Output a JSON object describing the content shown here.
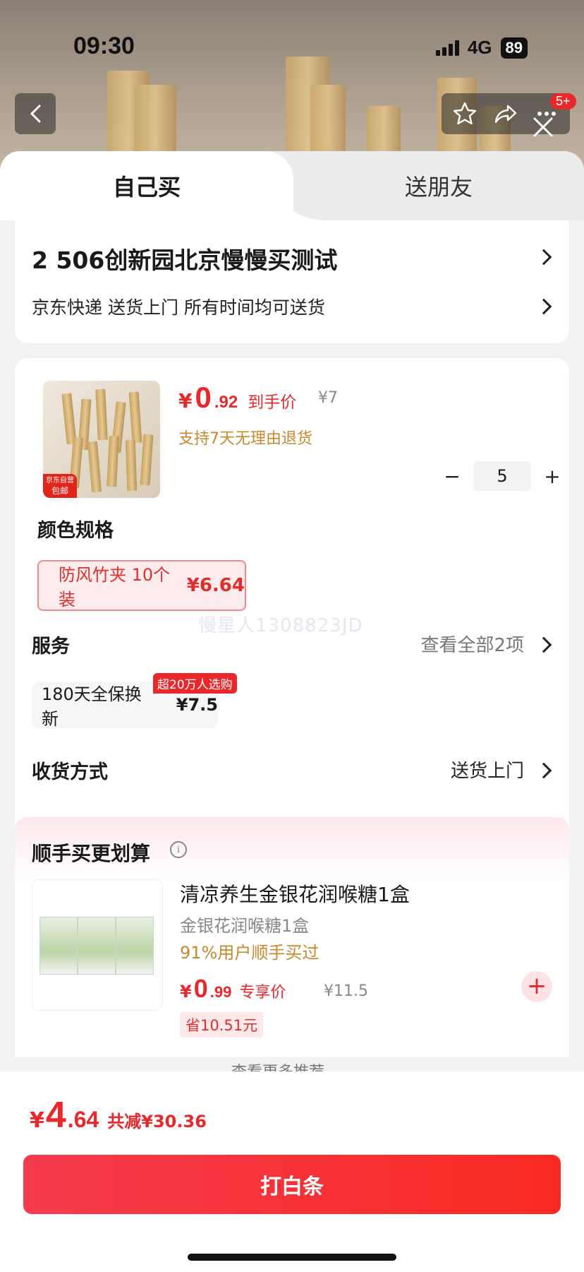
{
  "status": {
    "time": "09:30",
    "network": "4G",
    "battery": "89"
  },
  "topbar": {
    "badge": "5+"
  },
  "tabs": {
    "self": "自己买",
    "gift": "送朋友"
  },
  "address": {
    "title": "2  506创新园北京慢慢买测试",
    "delivery": "京东快递 送货上门 所有时间均可送货"
  },
  "product": {
    "tag_line1": "京东自营",
    "tag_line2": "包邮",
    "price_symbol": "¥",
    "price_int": "0",
    "price_dec": ".92",
    "price_label": "到手价",
    "original_price": "¥7",
    "return_note": "支持7天无理由退货",
    "quantity": "5",
    "minus": "−",
    "plus": "+"
  },
  "spec": {
    "label": "颜色规格",
    "option": "防风竹夹 10个装",
    "option_price": "¥6.64"
  },
  "watermark": "慢星人1308823JD",
  "service": {
    "label": "服务",
    "more": "查看全部2项",
    "item": "180天全保换新",
    "item_price": "¥7.5",
    "tag": "超20万人选购"
  },
  "delivery_method": {
    "label": "收货方式",
    "value": "送货上门"
  },
  "recommend": {
    "title": "顺手买更划算",
    "info": "i",
    "name": "清凉养生金银花润喉糖1盒",
    "sub": "金银花润喉糖1盒",
    "pct": "91%用户顺手买过",
    "price_symbol": "¥",
    "price_int": "0",
    "price_dec": ".99",
    "price_label": "专享价",
    "original_price": "¥11.5",
    "save": "省10.51元",
    "add": "+",
    "more": "查看更多推荐"
  },
  "footer": {
    "total_symbol": "¥",
    "total_int": "4",
    "total_dec": ".64",
    "discount": "共减¥30.36",
    "pay_button": "打白条"
  },
  "colors": {
    "accent": "#e8282b",
    "gold": "#c8892e"
  }
}
